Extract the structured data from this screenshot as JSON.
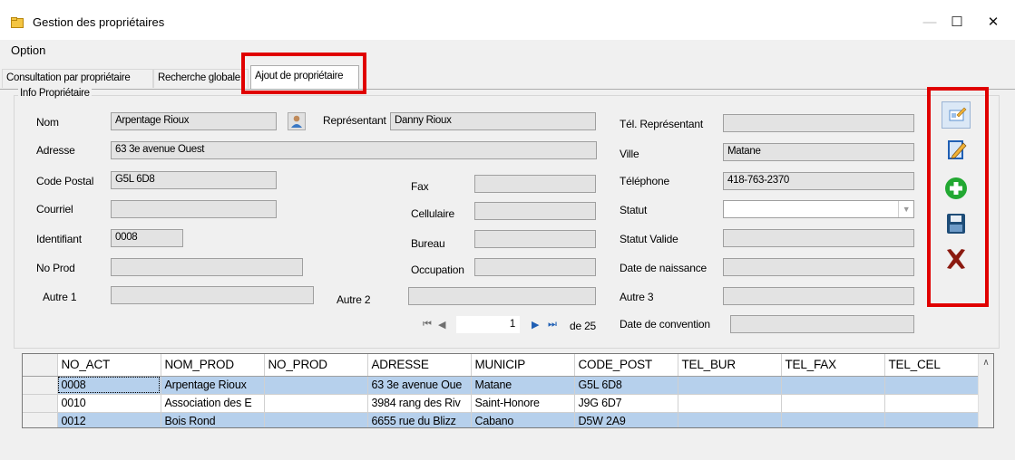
{
  "window": {
    "title": "Gestion des propriétaires",
    "minimize": "—",
    "maximize": "☐",
    "close": "✕"
  },
  "menu": {
    "option": "Option"
  },
  "tabs": [
    "Consultation par propriétaire",
    "Recherche globale",
    "Ajout de propriétaire"
  ],
  "group": {
    "title": "Info Propriétaire"
  },
  "form": {
    "nom_label": "Nom",
    "nom_value": "Arpentage Rioux",
    "representant_label": "Représentant",
    "representant_value": "Danny Rioux",
    "tel_rep_label": "Tél. Représentant",
    "tel_rep_value": "",
    "adresse_label": "Adresse",
    "adresse_value": "63 3e avenue Ouest",
    "ville_label": "Ville",
    "ville_value": "Matane",
    "code_postal_label": "Code Postal",
    "code_postal_value": "G5L 6D8",
    "fax_label": "Fax",
    "fax_value": "",
    "telephone_label": "Téléphone",
    "telephone_value": "418-763-2370",
    "courriel_label": "Courriel",
    "courriel_value": "",
    "cellulaire_label": "Cellulaire",
    "cellulaire_value": "",
    "statut_label": "Statut",
    "statut_value": "",
    "identifiant_label": "Identifiant",
    "identifiant_value": "0008",
    "bureau_label": "Bureau",
    "bureau_value": "",
    "statut_valide_label": "Statut Valide",
    "statut_valide_value": "",
    "no_prod_label": "No Prod",
    "no_prod_value": "",
    "occupation_label": "Occupation",
    "occupation_value": "",
    "date_naissance_label": "Date de naissance",
    "date_naissance_value": "",
    "autre1_label": "Autre 1",
    "autre1_value": "",
    "autre2_label": "Autre 2",
    "autre2_value": "",
    "autre3_label": "Autre 3",
    "autre3_value": "",
    "date_convention_label": "Date de convention",
    "date_convention_value": ""
  },
  "navigator": {
    "first": "⏮",
    "prev": "◀",
    "position": "1",
    "next": "▶",
    "last": "⏭",
    "of_label": "de 25"
  },
  "toolbar": [
    "edit-card-icon",
    "edit-pencil-icon",
    "add-plus-icon",
    "save-disk-icon",
    "delete-x-icon"
  ],
  "colors": {
    "highlight": "#e00000",
    "selected_row": "#b6d0ec",
    "add_green": "#22a832",
    "delete_red": "#8b1a10",
    "edit_blue": "#1f5fb4"
  },
  "grid": {
    "columns": [
      "NO_ACT",
      "NOM_PROD",
      "NO_PROD",
      "ADRESSE",
      "MUNICIP",
      "CODE_POST",
      "TEL_BUR",
      "TEL_FAX",
      "TEL_CEL"
    ],
    "rows": [
      [
        "0008",
        "Arpentage Rioux",
        "",
        "63 3e avenue Oue",
        "Matane",
        "G5L 6D8",
        "",
        "",
        ""
      ],
      [
        "0010",
        "Association des E",
        "",
        "3984 rang des Riv",
        "Saint-Honore",
        "J9G 6D7",
        "",
        "",
        ""
      ],
      [
        "0012",
        "Bois Rond",
        "",
        "6655 rue du Blizz",
        "Cabano",
        "D5W 2A9",
        "",
        "",
        ""
      ]
    ]
  }
}
